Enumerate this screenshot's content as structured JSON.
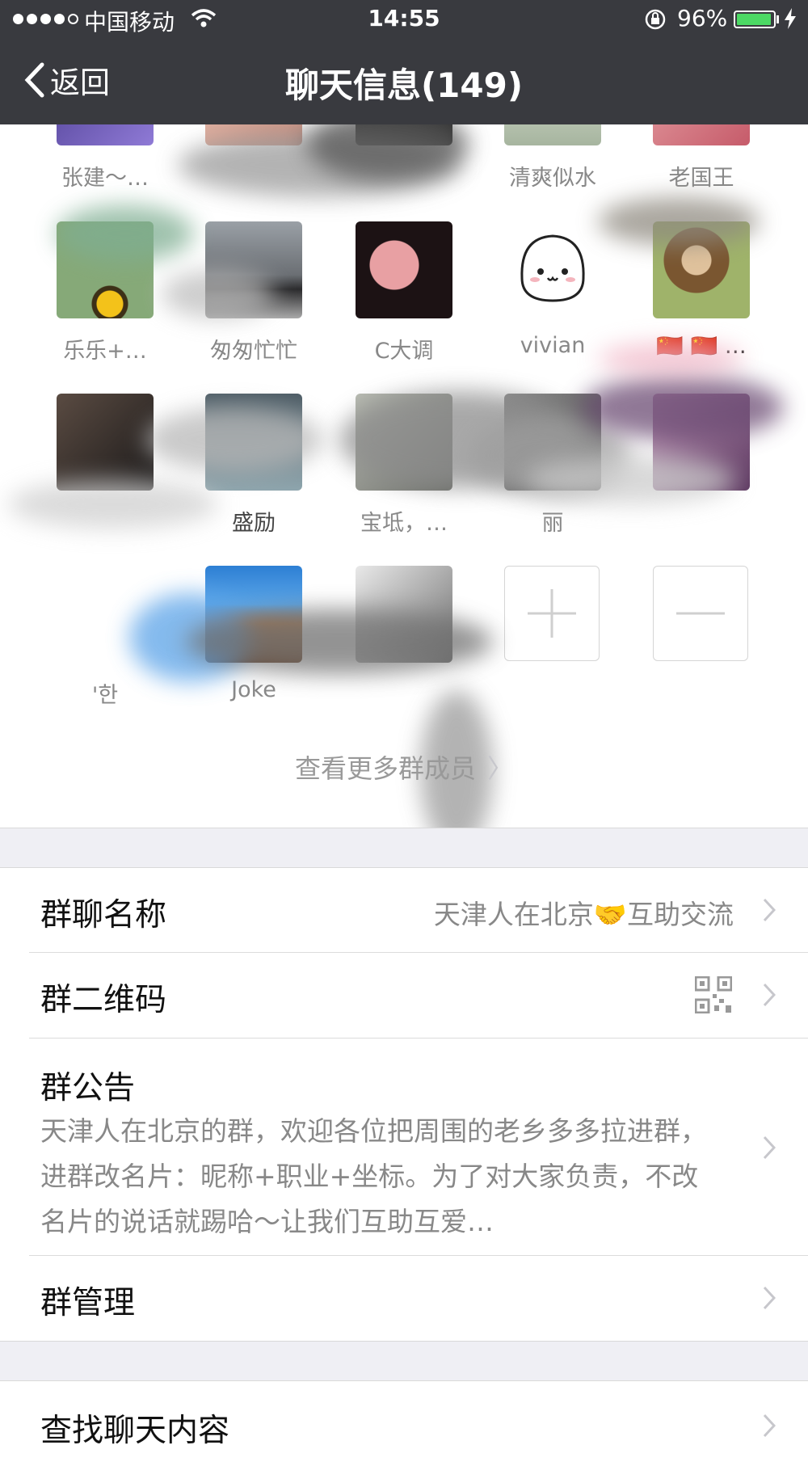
{
  "status_bar": {
    "carrier": "中国移动",
    "time": "14:55",
    "battery": "96%",
    "battery_level": 0.96
  },
  "nav": {
    "back_label": "返回",
    "title": "聊天信息(149)"
  },
  "members": [
    {
      "name": "张建～…"
    },
    {
      "name": ""
    },
    {
      "name": ""
    },
    {
      "name": "清爽似水"
    },
    {
      "name": "老国王"
    },
    {
      "name": "乐乐+…"
    },
    {
      "name": "匆匆忙忙"
    },
    {
      "name": "C大调"
    },
    {
      "name": "vivian"
    },
    {
      "name": "🇨🇳 🇨🇳 …"
    },
    {
      "name": ""
    },
    {
      "name": "盛励"
    },
    {
      "name": "宝坻，…"
    },
    {
      "name": "丽"
    },
    {
      "name": ""
    },
    {
      "name": "'한"
    },
    {
      "name": "Joke"
    },
    {
      "name": ""
    }
  ],
  "more_members": "查看更多群成员",
  "settings": {
    "group_name_label": "群聊名称",
    "group_name_value": "天津人在北京🤝互助交流",
    "qr_label": "群二维码",
    "notice_label": "群公告",
    "notice_text": "天津人在北京的群，欢迎各位把周围的老乡多多拉进群，进群改名片：昵称+职业+坐标。为了对大家负责，不改名片的说话就踢哈～让我们互助互爱…",
    "manage_label": "群管理",
    "search_label": "查找聊天内容"
  },
  "colors": {
    "nav_bg": "#393a3f",
    "page_bg": "#efeff4",
    "battery_green": "#4cd964"
  }
}
